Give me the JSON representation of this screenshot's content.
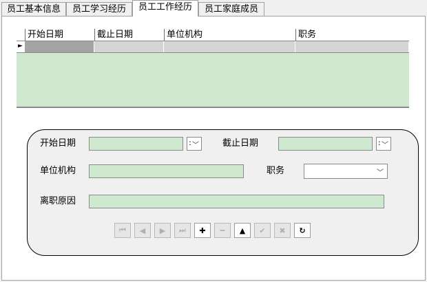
{
  "tabs": [
    {
      "label": "员工基本信息"
    },
    {
      "label": "员工学习经历"
    },
    {
      "label": "员工工作经历"
    },
    {
      "label": "员工家庭成员"
    }
  ],
  "active_tab": 2,
  "grid": {
    "columns": [
      "开始日期",
      "截止日期",
      "单位机构",
      "职务"
    ],
    "row_indicator": "►"
  },
  "form": {
    "start_date_label": "开始日期",
    "start_date_value": "",
    "end_date_label": "截止日期",
    "end_date_value": "",
    "org_label": "单位机构",
    "org_value": "",
    "position_label": "职务",
    "position_value": "",
    "reason_label": "离职原因",
    "reason_value": ""
  },
  "navigator": [
    {
      "name": "first-record-button",
      "glyph": "⏮",
      "enabled": false
    },
    {
      "name": "prior-record-button",
      "glyph": "◀",
      "enabled": false
    },
    {
      "name": "next-record-button",
      "glyph": "▶",
      "enabled": false
    },
    {
      "name": "last-record-button",
      "glyph": "⏭",
      "enabled": false
    },
    {
      "name": "insert-button",
      "glyph": "✚",
      "enabled": true
    },
    {
      "name": "delete-button",
      "glyph": "━",
      "enabled": false
    },
    {
      "name": "edit-button",
      "glyph": "▲",
      "enabled": true
    },
    {
      "name": "post-button",
      "glyph": "✔",
      "enabled": false
    },
    {
      "name": "cancel-button",
      "glyph": "✖",
      "enabled": false
    },
    {
      "name": "refresh-button",
      "glyph": "↻",
      "enabled": true
    }
  ],
  "colors": {
    "field_green": "#cfe8d0",
    "grid_green": "#cfe8d0"
  }
}
